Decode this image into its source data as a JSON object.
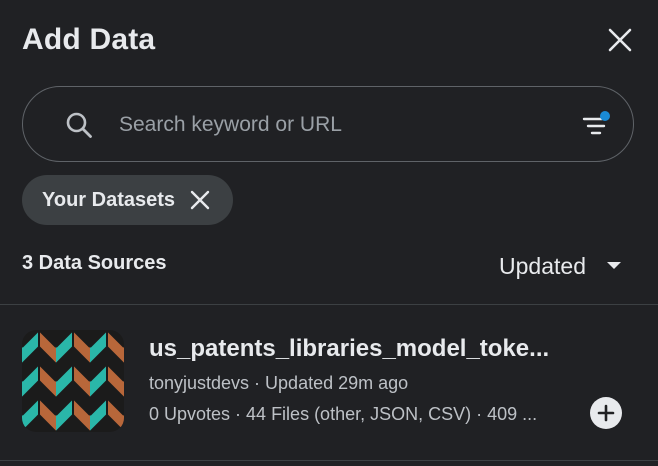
{
  "panel": {
    "title": "Add Data",
    "close_icon": "close-icon"
  },
  "search": {
    "placeholder": "Search keyword or URL",
    "value": "",
    "search_icon": "search-icon",
    "filter_icon": "filter-icon",
    "filter_active_color": "#1a8ad4"
  },
  "filter_chip": {
    "label": "Your Datasets",
    "remove_icon": "close-icon"
  },
  "results": {
    "count_label": "3 Data Sources",
    "sort": {
      "selected": "Updated",
      "icon": "caret-down-icon"
    }
  },
  "datasets": [
    {
      "title": "us_patents_libraries_model_toke...",
      "owner": "tonyjustdevs",
      "updated": "Updated 29m ago",
      "meta": "tonyjustdevs · Updated 29m ago",
      "stats": "0 Upvotes · 44 Files (other, JSON, CSV) · 409 ...",
      "thumbnail_colors": [
        "#2ab7a9",
        "#b8673a",
        "#1b1b1b"
      ],
      "add_icon": "plus-icon"
    }
  ],
  "colors": {
    "background": "#202124",
    "chip_background": "#3c4043",
    "text_primary": "#e8eaed",
    "text_secondary": "#bdc1c6",
    "border": "#5f6368"
  }
}
